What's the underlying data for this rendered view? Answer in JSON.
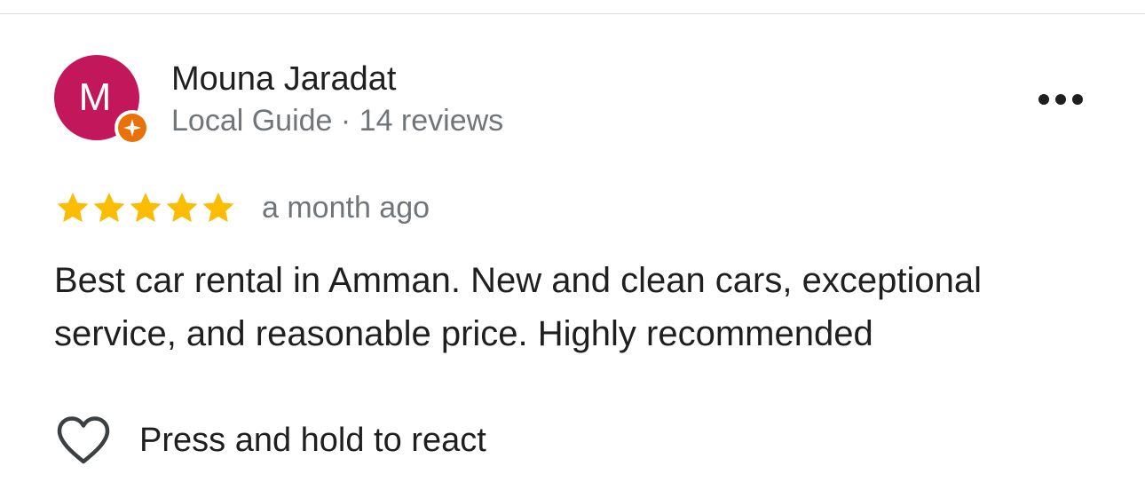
{
  "review": {
    "author": {
      "initial": "M",
      "name": "Mouna Jaradat",
      "meta": "Local Guide · 14 reviews",
      "avatar_color": "#c2185b",
      "badge_color": "#e8710a",
      "badge_icon": "local-guide-star-icon"
    },
    "rating": 5,
    "rating_max": 5,
    "star_color": "#fbbc04",
    "time": "a month ago",
    "text": "Best car rental in Amman. New and clean cars, exceptional service, and reasonable price. Highly recommended",
    "more_icon": "more-options-icon",
    "react": {
      "icon": "heart-icon",
      "label": "Press and hold to react"
    }
  }
}
